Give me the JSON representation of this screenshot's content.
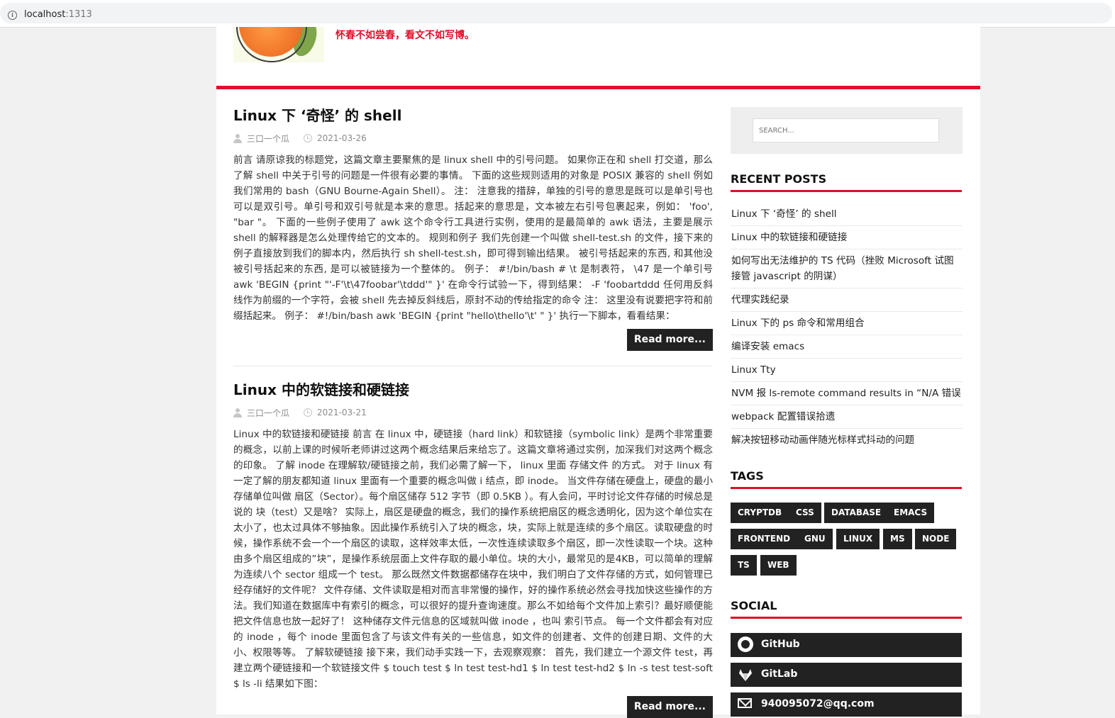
{
  "browser": {
    "host": "localhost",
    "port": ":1313"
  },
  "site": {
    "tagline": "怀春不如尝春，看文不如写博。"
  },
  "posts": [
    {
      "title": "Linux 下 ‘奇怪’ 的 shell",
      "author": "三口一个瓜",
      "date": "2021-03-26",
      "excerpt": "前言 请原谅我的标题党，这篇文章主要聚焦的是 linux shell 中的引号问题。 如果你正在和 shell 打交道，那么了解 shell 中关于引号的问题是一件很有必要的事情。 下面的这些规则适用的对象是 POSIX 兼容的 shell 例如我们常用的 bash（GNU Bourne-Again Shell）。 注： 注意我的措辞，单独的引号的意思是既可以是单引号也可以是双引号。单引号和双引号就是本来的意思。括起来的意思是，文本被左右引号包裹起来，例如： 'foo', \"bar \"。 下面的一些例子使用了 awk 这个命令行工具进行实例，使用的是最简单的 awk 语法，主要是展示 shell 的解释器是怎么处理传给它的文本的。 规则和例子 我们先创建一个叫做 shell-test.sh 的文件，接下来的例子直接放到我们的脚本内，然后执行 sh shell-test.sh，即可得到输出结果。 被引号括起来的东西, 和其他没被引号括起来的东西, 是可以被链接为一个整体的。 例子： #!/bin/bash # \\t 是制表符， \\47 是一个单引号 awk 'BEGIN {print \"'-F'\\t\\47foobar'\\tddd'\" }' 在命令行试验一下，得到结果： -F 'foobartddd 任何用反斜线作为前缀的一个字符，会被 shell 先去掉反斜线后，原封不动的传给指定的命令 注： 这里没有说要把字符和前缀括起来。 例子： #!/bin/bash awk 'BEGIN {print \"hello\\thello'\\t' \" }' 执行一下脚本，看看结果：",
      "read_more": "Read more..."
    },
    {
      "title": "Linux 中的软链接和硬链接",
      "author": "三口一个瓜",
      "date": "2021-03-21",
      "excerpt": "Linux 中的软链接和硬链接 前言 在 linux 中，硬链接（hard link）和软链接（symbolic link）是两个非常重要的概念，以前上课的时候听老师讲过这两个概念结果后来给忘了。这篇文章将通过实例，加深我们对这两个概念的印象。 了解 inode 在理解软/硬链接之前，我们必需了解一下， linux 里面 存储文件 的方式。 对于 linux 有一定了解的朋友都知道 linux 里面有一个重要的概念叫做 i 结点，即 inode。 当文件存储在硬盘上，硬盘的最小存储单位叫做 扇区（Sector）。每个扇区储存 512 字节（即 0.5KB ）。有人会问，平时讨论文件存储的时候总是说的 块（test）又是啥？ 实际上，扇区是硬盘的概念，我们的操作系统把扇区的概念透明化，因为这个单位实在太小了，也太过具体不够抽象。因此操作系统引入了块的概念，块，实际上就是连续的多个扇区。读取硬盘的时候，操作系统不会一个一个扇区的读取，这样效率太低，一次性连续读取多个扇区，即一次性读取一个块。这种由多个扇区组成的”块”，是操作系统层面上文件存取的最小单位。块的大小，最常见的是4KB，可以简单的理解为连续八个 sector 组成一个 test。 那么既然文件数据都储存在块中，我们明白了文件存储的方式，如何管理已经存储好的文件呢？ 文件存储、文件读取是相对而言非常慢的操作，好的操作系统必然会寻找加快这些操作的方法。我们知道在数据库中有索引的概念，可以很好的提升查询速度。那么不如给每个文件加上索引？最好顺便能把文件信息也放一起好了！ 这种储存文件元信息的区域就叫做 inode ，也叫 索引节点。 每一个文件都会有对应的 inode ，每个 inode 里面包含了与该文件有关的一些信息，如文件的创建者、文件的创建日期、文件的大小、权限等等。 了解软硬链接 接下来，我们动手实践一下，去观察观察： 首先，我们建立一个源文件 test，再建立两个硬链接和一个软链接文件 $ touch test $ ln test test-hd1 $ ln test test-hd2 $ ln -s test test-soft $ ls -li 结果如下图：",
      "read_more": "Read more..."
    }
  ],
  "sidebar": {
    "search_placeholder": "SEARCH...",
    "recent_title": "RECENT POSTS",
    "recent": [
      "Linux 下 ‘奇怪’ 的 shell",
      "Linux 中的软链接和硬链接",
      "如何写出无法维护的 TS 代码（挫败 Microsoft 试图接管 javascript 的阴谋）",
      "代理实践纪录",
      "Linux 下的 ps 命令和常用组合",
      "编译安装 emacs",
      "Linux Tty",
      "NVM 报 ls-remote command results in “N/A 错误",
      "webpack 配置错误拾遗",
      "解决按钮移动动画伴随光标样式抖动的问题"
    ],
    "tags_title": "TAGS",
    "tags": [
      "CRYPTDB",
      "CSS",
      "DATABASE",
      "EMACS",
      "FRONTEND",
      "GNU",
      "LINUX",
      "MS",
      "NODE",
      "TS",
      "WEB"
    ],
    "social_title": "SOCIAL",
    "social": [
      {
        "icon": "github-icon",
        "label": "GitHub"
      },
      {
        "icon": "gitlab-icon",
        "label": "GitLab"
      },
      {
        "icon": "mail-icon",
        "label": "940095072@qq.com"
      }
    ]
  }
}
